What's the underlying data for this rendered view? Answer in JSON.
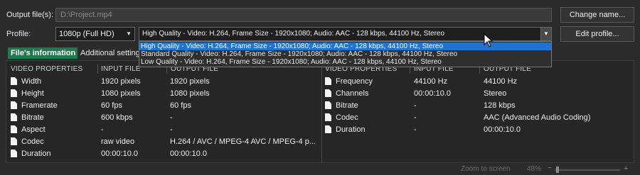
{
  "output": {
    "label": "Output file(s):",
    "path": "D:\\Project.mp4",
    "change_button": "Change name..."
  },
  "profile": {
    "label": "Profile:",
    "preset": "1080p (Full HD)",
    "selected": "High Quality - Video: H.264, Frame Size - 1920x1080; Audio: AAC - 128 kbps, 44100 Hz, Stereo",
    "edit_button": "Edit profile...",
    "options": [
      "High Quality - Video: H.264, Frame Size - 1920x1080; Audio: AAC - 128 kbps, 44100 Hz, Stereo",
      "Standard Quality - Video: H.264, Frame Size - 1920x1080; Audio: AAC - 128 kbps, 44100 Hz, Stereo",
      "Low Quality - Video: H.264, Frame Size - 1920x1080; Audio: AAC - 128 kbps, 44100 Hz, Stereo"
    ]
  },
  "tabs": {
    "file_info": "File's information",
    "additional": "Additional settings"
  },
  "video": {
    "headers": [
      "VIDEO PROPERTIES",
      "INPUT FILE",
      "OUTPUT FILE"
    ],
    "rows": [
      {
        "prop": "Width",
        "input": "1920 pixels",
        "output": "1920 pixels"
      },
      {
        "prop": "Height",
        "input": "1080 pixels",
        "output": "1080 pixels"
      },
      {
        "prop": "Framerate",
        "input": "60 fps",
        "output": "60 fps"
      },
      {
        "prop": "Bitrate",
        "input": "600 kbps",
        "output": "-"
      },
      {
        "prop": "Aspect",
        "input": "-",
        "output": "-"
      },
      {
        "prop": "Codec",
        "input": "raw video",
        "output": "H.264 / AVC / MPEG-4 AVC / MPEG-4 p..."
      },
      {
        "prop": "Duration",
        "input": "00:00:10.0",
        "output": "00:00:10.0"
      }
    ]
  },
  "audio": {
    "headers": [
      "VIDEO PROPERTIES",
      "INPUT FILE",
      "OUTPUT FILE"
    ],
    "rows": [
      {
        "prop": "Frequency",
        "input": "44100 Hz",
        "output": "44100 Hz"
      },
      {
        "prop": "Channels",
        "input": "00:00:10.0",
        "output": "Stereo"
      },
      {
        "prop": "Bitrate",
        "input": "-",
        "output": "128 kbps"
      },
      {
        "prop": "Codec",
        "input": "-",
        "output": "AAC (Advanced Audio Coding)"
      },
      {
        "prop": "Duration",
        "input": "-",
        "output": "00:00:10.0"
      }
    ]
  },
  "status": {
    "zoom_label": "Zoom to screen",
    "zoom_value": "48%",
    "minus": "−",
    "plus": "+"
  }
}
